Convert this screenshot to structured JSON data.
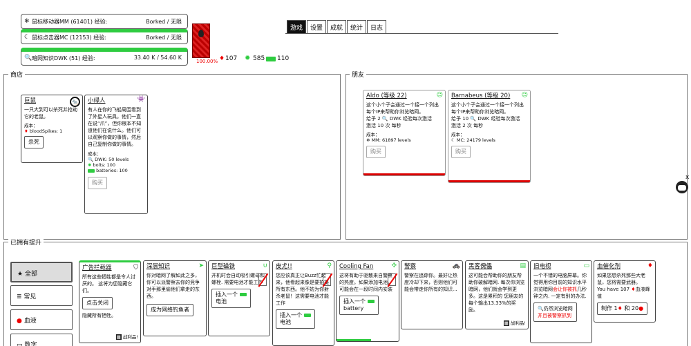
{
  "stats": [
    {
      "icon": "❄",
      "label": "鼠标移动器MM (61401) 经验:",
      "value": "Borked / 无限",
      "fill": 1.0
    },
    {
      "icon": "☾",
      "label": "鼠标点击器MC (12153) 经验:",
      "value": "Borked / 无限",
      "fill": 1.0
    },
    {
      "icon": "🔍",
      "label": "暗网知识DWK (51) 经验:",
      "value": "33.40 K / 54.60 K",
      "fill": 0.61
    }
  ],
  "blood": {
    "percent": "100.00%",
    "drops": "107",
    "bolts": "585",
    "batteries": "110"
  },
  "tabs": [
    "游戏",
    "设置",
    "成就",
    "统计",
    "日志"
  ],
  "shop": {
    "title": "商店",
    "cards": [
      {
        "name": "巨鼠",
        "desc": "一只大到可以杀死并抢劫它的老鼠。",
        "cost_label": "成本：",
        "costs": [
          "bloodSpikes: 1"
        ],
        "button": "杀死"
      },
      {
        "name": "小绿人",
        "desc": "有人在你的飞船周围看到了外星人玩具。他们一直在说“爪”，但你根本不知道他们在说什么。他们可以观察你做的事情，然后自己复制你做的事情。",
        "cost_label": "成本：",
        "costs": [
          "DWK: 50 levels",
          "bolts: 100",
          "batteries: 100"
        ],
        "button": "购买"
      }
    ]
  },
  "friends": {
    "title": "朋友",
    "cards": [
      {
        "name": "Aldo (等级 22)",
        "desc1": "这个小个子会通过一个接一个列出每个IP来帮助你浏览暗网。",
        "desc2a": "给予 2",
        "desc2b": "DWK 经验每次激活",
        "desc3": "激活 10 次 每秒",
        "cost_label": "成本：",
        "cost": "MM: 61897 levels",
        "button": "购买"
      },
      {
        "name": "Barnabeus (等级 20)",
        "desc1": "这个小个子会通过一个接一个列出每个IP来帮助你浏览暗网。",
        "desc2a": "给予 10",
        "desc2b": "DWK 经验每次激活",
        "desc3": "激活 2 次 每秒",
        "cost_label": "成本：",
        "cost": "MC: 24179 levels",
        "button": "购买"
      }
    ]
  },
  "upgrades": {
    "title": "已拥有提升",
    "categories": [
      "全部",
      "常见",
      "血液",
      "数字"
    ],
    "cards": [
      {
        "name": "广告拦截器",
        "desc": "所有这些牺牲都是令人讨厌的。 这将为您隐藏它们。",
        "button": "点击关闭",
        "extra": "隐藏所有牺牲。",
        "tag": "战利品!"
      },
      {
        "name": "深层知识",
        "desc": "你对暗网了解如此之多，你可以派警察去你的竞争对手那里偷他们拿走的东西。",
        "button": "成为网络钓鱼者"
      },
      {
        "name": "巨型磁铁",
        "desc": "开机时会自动吸引螺母和螺栓. 需要电池才能工作",
        "button_a": "插入一个",
        "button_b": "电池"
      },
      {
        "name": "皮尤!!",
        "desc": "您应该真正让Buzz忙起来，他看起来像是要拍摄所有东西。他不妨为你射杀老鼠！这需要电池才能工作",
        "button_a": "插入一个",
        "button_b": "电池"
      },
      {
        "name": "Cooling Fan",
        "desc": "这将有助于驱散来自警察的热度。如果添加电池，可能会在一段时间内安装",
        "button_a": "插入一个",
        "button_b": "battery"
      },
      {
        "name": "警察",
        "desc": "警察在追踪你。最好让热度冷却下来，否则他们可能会带走你所有的知识..."
      },
      {
        "name": "黑客傀儡",
        "desc": "这可能会帮助你的朋友帮助你破解暗网. 每次你浏览暗网，他们就会学到更多。这是累积的 您朋友的每个输出13.33%的奖励。",
        "tag": "战利品!"
      },
      {
        "name": "旧电视",
        "desc": "一个不错的电脑屏幕。你觉得用你目前的知识水平浏览暗网",
        "warn": "会让你被抓",
        "desc2": "几秒钟之内. 一定有别的办法.",
        "button_a": "仍然浏览暗网",
        "button_b": "并且被警察抓到"
      },
      {
        "name": "血催化剂",
        "desc": "如果您想杀死那些大老鼠，您将需要武器。",
        "have_a": "You have 107",
        "have_b": "血液峰值",
        "button_a": "制作 1",
        "button_b": "和 20"
      }
    ]
  },
  "close_x": "x"
}
